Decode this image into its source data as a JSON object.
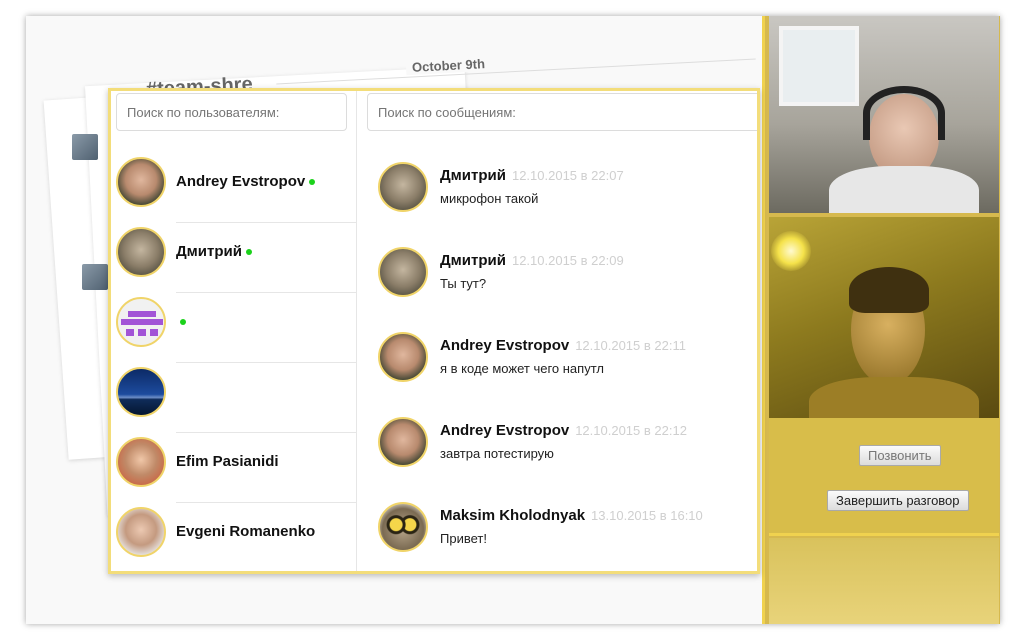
{
  "background": {
    "channel": "#team-shre",
    "date": "October 9th"
  },
  "users_panel": {
    "search_placeholder": "Поиск по пользователям:",
    "users": [
      {
        "name": "Andrey Evstropov",
        "online": true,
        "avatar": "photo"
      },
      {
        "name": "Дмитрий",
        "online": true,
        "avatar": "photo"
      },
      {
        "name": "",
        "online": true,
        "avatar": "pixel-identicon"
      },
      {
        "name": "",
        "online": false,
        "avatar": "city-skyline"
      },
      {
        "name": "Efim Pasianidi",
        "online": false,
        "avatar": "photo"
      },
      {
        "name": "Evgeni Romanenko",
        "online": false,
        "avatar": "photo"
      }
    ]
  },
  "messages_panel": {
    "search_placeholder": "Поиск по сообщениям:",
    "messages": [
      {
        "author": "Дмитрий",
        "time": "12.10.2015 в 22:07",
        "text": "микрофон такой"
      },
      {
        "author": "Дмитрий",
        "time": "12.10.2015 в 22:09",
        "text": "Ты тут?"
      },
      {
        "author": "Andrey Evstropov",
        "time": "12.10.2015 в 22:11",
        "text": "я в коде может чего напутл"
      },
      {
        "author": "Andrey Evstropov",
        "time": "12.10.2015 в 22:12",
        "text": "завтра потестирую"
      },
      {
        "author": "Maksim Kholodnyak",
        "time": "13.10.2015 в 16:10",
        "text": "Привет!"
      }
    ]
  },
  "video_panel": {
    "call_label": "Позвонить",
    "end_label": "Завершить разговор"
  },
  "colors": {
    "accent": "#f0d24f",
    "online": "#1bd21b",
    "timestamp": "#cfcfcf"
  }
}
